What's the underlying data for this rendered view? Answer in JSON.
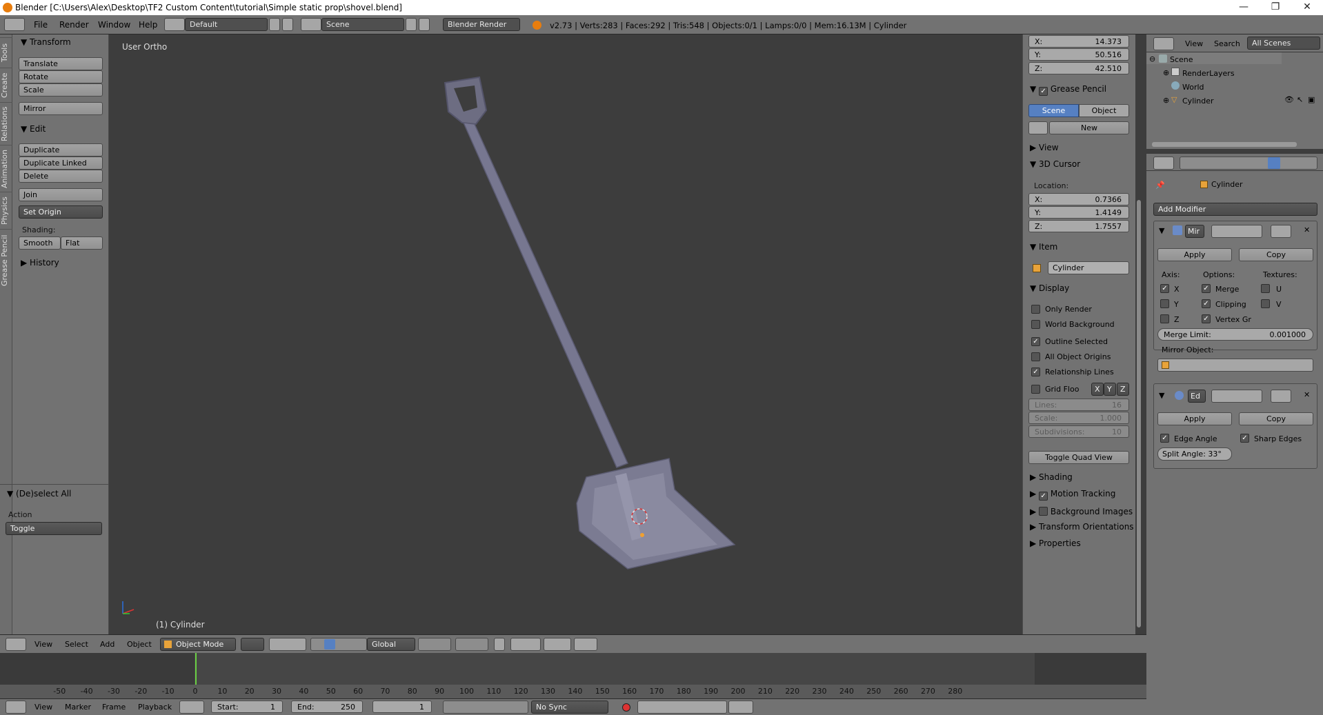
{
  "window": {
    "title": "Blender [C:\\Users\\Alex\\Desktop\\TF2 Custom Content\\tutorial\\Simple static prop\\shovel.blend]",
    "minimize": "—",
    "maximize": "❐",
    "close": "✕"
  },
  "info_header": {
    "menus": [
      "File",
      "Render",
      "Window",
      "Help"
    ],
    "layout": "Default",
    "scene": "Scene",
    "engine": "Blender Render",
    "stats": "v2.73 | Verts:283 | Faces:292 | Tris:548 | Objects:0/1 | Lamps:0/0 | Mem:16.13M | Cylinder"
  },
  "tool_tabs": [
    "Tools",
    "Create",
    "Relations",
    "Animation",
    "Physics",
    "Grease Pencil"
  ],
  "toolshelf": {
    "transform_title": "Transform",
    "translate": "Translate",
    "rotate": "Rotate",
    "scale": "Scale",
    "mirror": "Mirror",
    "edit_title": "Edit",
    "duplicate": "Duplicate",
    "duplicate_linked": "Duplicate Linked",
    "delete": "Delete",
    "join": "Join",
    "set_origin": "Set Origin",
    "shading_label": "Shading:",
    "smooth": "Smooth",
    "flat": "Flat",
    "history_title": "History",
    "operator_title": "(De)select All",
    "action_label": "Action",
    "action_value": "Toggle"
  },
  "viewport": {
    "view_label": "User Ortho",
    "object_label": "(1) Cylinder"
  },
  "npanel": {
    "rot_x_label": "X:",
    "rot_x": "14.373",
    "rot_y_label": "Y:",
    "rot_y": "50.516",
    "rot_z_label": "Z:",
    "rot_z": "42.510",
    "grease_pencil": "Grease Pencil",
    "scene_tab": "Scene",
    "object_tab": "Object",
    "new": "New",
    "view": "View",
    "cursor_title": "3D Cursor",
    "location_label": "Location:",
    "cur_x_label": "X:",
    "cur_x": "0.7366",
    "cur_y_label": "Y:",
    "cur_y": "1.4149",
    "cur_z_label": "Z:",
    "cur_z": "1.7557",
    "item_title": "Item",
    "item_name": "Cylinder",
    "display_title": "Display",
    "only_render": "Only Render",
    "world_background": "World Background",
    "outline_selected": "Outline Selected",
    "all_object_origins": "All Object Origins",
    "relationship_lines": "Relationship Lines",
    "grid_floor": "Grid Floo",
    "axis_x": "X",
    "axis_y": "Y",
    "axis_z": "Z",
    "lines_label": "Lines:",
    "lines": "16",
    "scale_label": "Scale:",
    "scale": "1.000",
    "subdiv_label": "Subdivisions:",
    "subdiv": "10",
    "toggle_quad": "Toggle Quad View",
    "shading": "Shading",
    "motion_tracking": "Motion Tracking",
    "background_images": "Background Images",
    "transform_orientations": "Transform Orientations",
    "properties": "Properties"
  },
  "outliner": {
    "view": "View",
    "search": "Search",
    "filter": "All Scenes",
    "scene": "Scene",
    "render_layers": "RenderLayers",
    "world": "World",
    "cylinder": "Cylinder"
  },
  "properties": {
    "object_name": "Cylinder",
    "add_modifier": "Add Modifier",
    "mirror_name": "Mir",
    "apply": "Apply",
    "copy": "Copy",
    "axis_label": "Axis:",
    "options_label": "Options:",
    "textures_label": "Textures:",
    "x": "X",
    "y": "Y",
    "z": "Z",
    "merge": "Merge",
    "clipping": "Clipping",
    "vertex_gr": "Vertex Gr",
    "u": "U",
    "v": "V",
    "merge_limit_label": "Merge Limit:",
    "merge_limit": "0.001000",
    "mirror_object_label": "Mirror Object:",
    "edge_name": "Ed",
    "edge_angle": "Edge Angle",
    "sharp_edges": "Sharp Edges",
    "split_angle": "Split Angle: 33°"
  },
  "viewport_header": {
    "menus": [
      "View",
      "Select",
      "Add",
      "Object"
    ],
    "mode": "Object Mode",
    "orientation": "Global"
  },
  "timeline": {
    "ticks": [
      "-50",
      "-40",
      "-30",
      "-20",
      "-10",
      "0",
      "10",
      "20",
      "30",
      "40",
      "50",
      "60",
      "70",
      "80",
      "90",
      "100",
      "110",
      "120",
      "130",
      "140",
      "150",
      "160",
      "170",
      "180",
      "190",
      "200",
      "210",
      "220",
      "230",
      "240",
      "250",
      "260",
      "270",
      "280"
    ],
    "menus": [
      "View",
      "Marker",
      "Frame",
      "Playback"
    ],
    "start_label": "Start:",
    "start": "1",
    "end_label": "End:",
    "end": "250",
    "current": "1",
    "sync": "No Sync"
  }
}
